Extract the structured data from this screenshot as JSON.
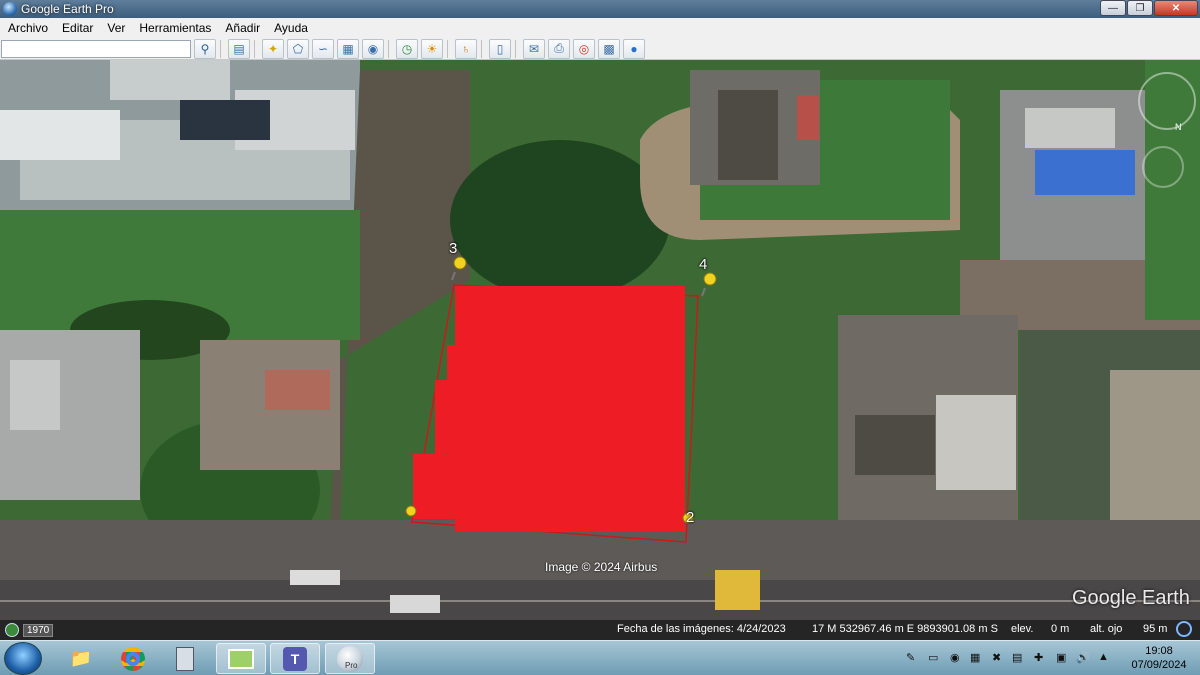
{
  "window": {
    "title": "Google Earth Pro"
  },
  "menu": {
    "items": [
      "Archivo",
      "Editar",
      "Ver",
      "Herramientas",
      "Añadir",
      "Ayuda"
    ]
  },
  "toolbar": {
    "search_value": ""
  },
  "map": {
    "placemarks": [
      "3",
      "4",
      "2"
    ],
    "copyright": "Image © 2024 Airbus",
    "logo": "Google Earth",
    "compass_n": "N"
  },
  "status": {
    "year": "1970",
    "imagery_date": "Fecha de las imágenes: 4/24/2023",
    "coords": "17 M 532967.46 m E 9893901.08 m S",
    "elev_label": "elev.",
    "elev_value": "0 m",
    "eye_label": "alt. ojo",
    "eye_value": "95 m"
  },
  "taskbar": {
    "time": "19:08",
    "date": "07/09/2024",
    "pro_badge": "Pro"
  },
  "colors": {
    "overlay_red": "#ee1c25",
    "titlebar": "#4a6a8a",
    "taskbar": "#8ab3c7"
  }
}
